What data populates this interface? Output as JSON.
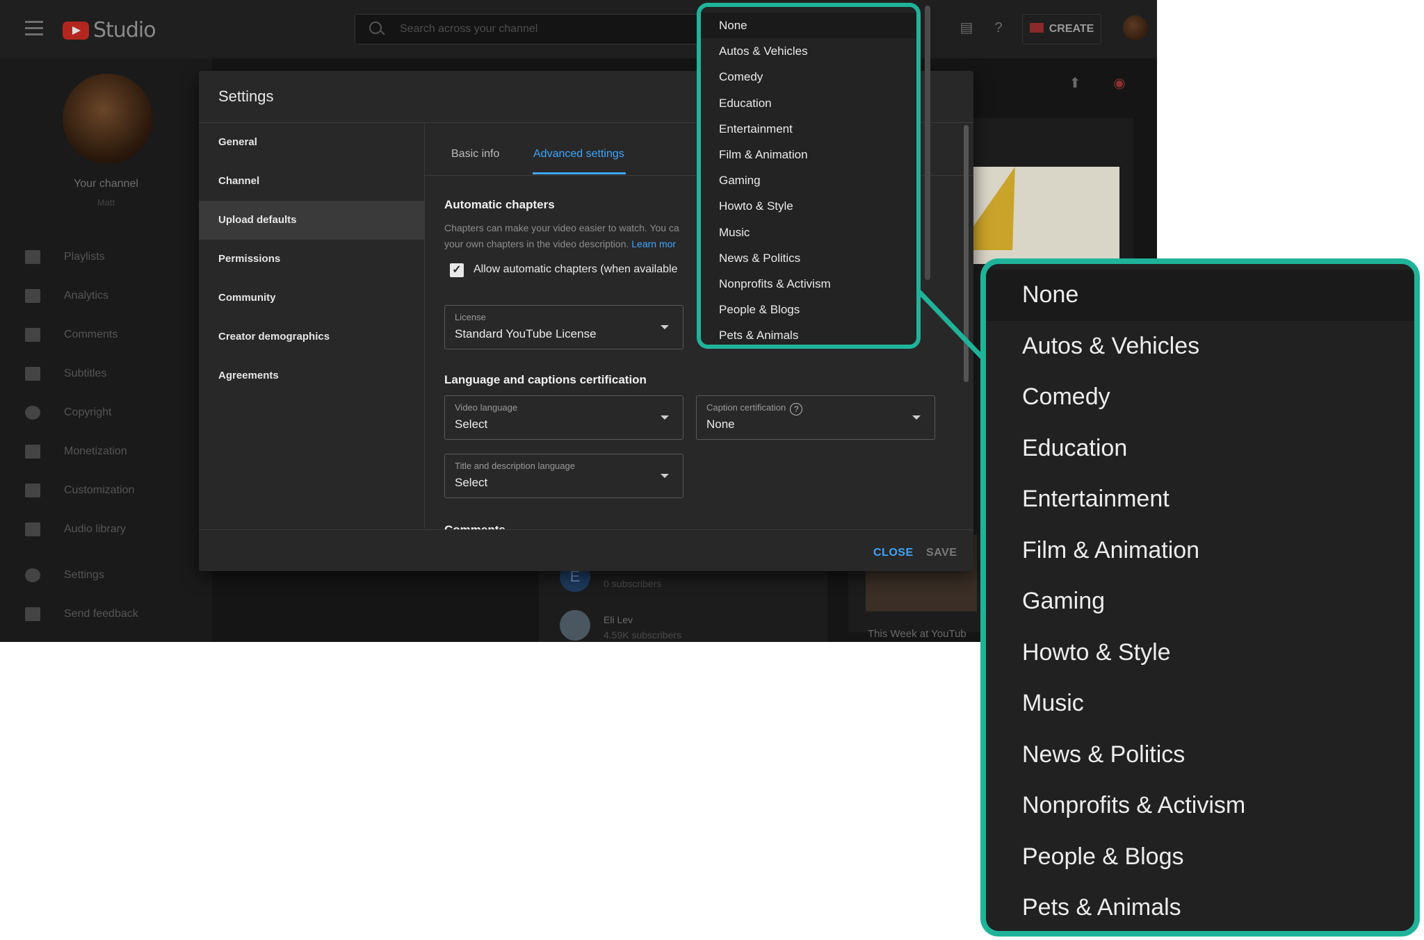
{
  "topbar": {
    "studio_label": "Studio",
    "search_placeholder": "Search across your channel",
    "create_label": "CREATE"
  },
  "sidebar": {
    "channel_title": "Your channel",
    "channel_name": "Matt",
    "items": [
      {
        "label": "Playlists"
      },
      {
        "label": "Analytics"
      },
      {
        "label": "Comments"
      },
      {
        "label": "Subtitles"
      },
      {
        "label": "Copyright"
      },
      {
        "label": "Monetization"
      },
      {
        "label": "Customization"
      },
      {
        "label": "Audio library"
      },
      {
        "label": "Settings"
      },
      {
        "label": "Send feedback"
      }
    ]
  },
  "background": {
    "sub1_initial": "E",
    "sub1_count": "0 subscribers",
    "sub2_name": "Eli Lev",
    "sub2_count": "4.59K subscribers",
    "video_title": "This Week at YouTub"
  },
  "settings_dialog": {
    "title": "Settings",
    "nav": [
      {
        "label": "General"
      },
      {
        "label": "Channel"
      },
      {
        "label": "Upload defaults",
        "selected": true
      },
      {
        "label": "Permissions"
      },
      {
        "label": "Community"
      },
      {
        "label": "Creator demographics"
      },
      {
        "label": "Agreements"
      }
    ],
    "tabs": [
      {
        "label": "Basic info"
      },
      {
        "label": "Advanced settings",
        "active": true
      }
    ],
    "auto_chapters": {
      "heading": "Automatic chapters",
      "desc_line1": "Chapters can make your video easier to watch. You ca",
      "desc_line2": "your own chapters in the video description. ",
      "learn_more": "Learn mor",
      "checkbox_label": "Allow automatic chapters (when available",
      "checked": true
    },
    "license": {
      "label": "License",
      "value": "Standard YouTube License"
    },
    "lang_heading": "Language and captions certification",
    "video_language": {
      "label": "Video language",
      "value": "Select"
    },
    "caption_cert": {
      "label": "Caption certification",
      "value": "None"
    },
    "title_desc_language": {
      "label": "Title and description language",
      "value": "Select"
    },
    "comments_heading": "Comments",
    "close_label": "CLOSE",
    "save_label": "SAVE"
  },
  "category_dropdown": {
    "options": [
      "None",
      "Autos & Vehicles",
      "Comedy",
      "Education",
      "Entertainment",
      "Film & Animation",
      "Gaming",
      "Howto & Style",
      "Music",
      "News & Politics",
      "Nonprofits & Activism",
      "People & Blogs",
      "Pets & Animals"
    ],
    "highlight_color": "#1fb39a"
  },
  "colors": {
    "accent_blue": "#3ea6ff",
    "callout_teal": "#1fb39a",
    "dialog_bg": "#282828"
  }
}
